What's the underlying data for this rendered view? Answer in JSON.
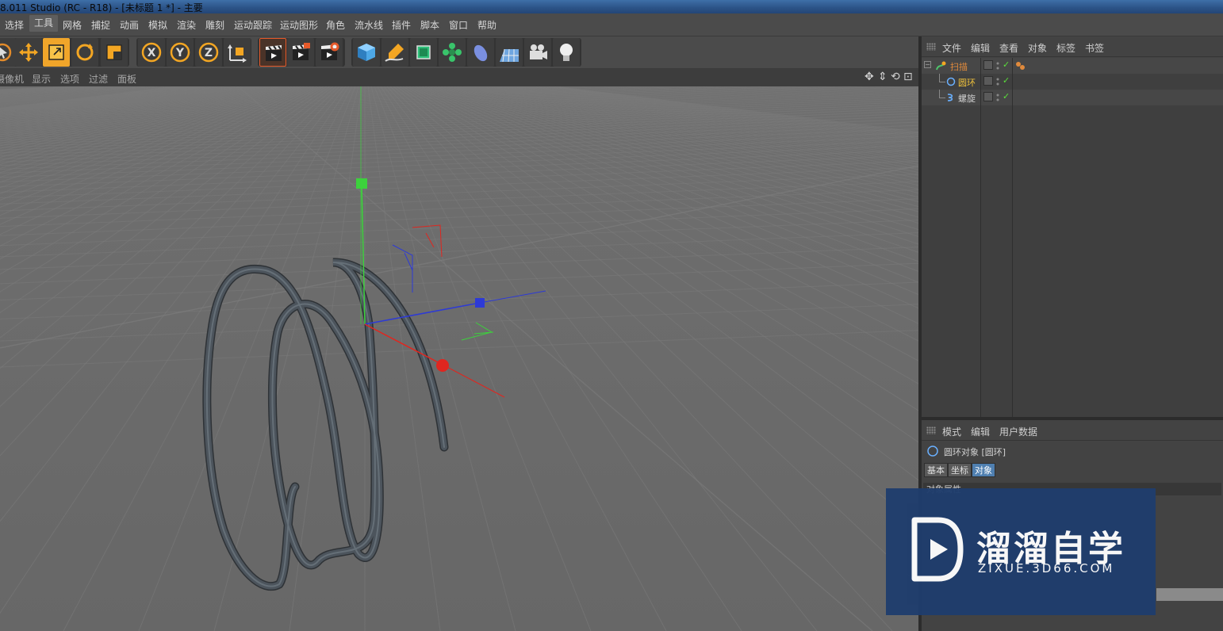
{
  "window": {
    "title": "8.011 Studio (RC - R18) - [未标题 1 *] - 主要"
  },
  "menu": {
    "items": [
      "选择",
      "工具",
      "网格",
      "捕捉",
      "动画",
      "模拟",
      "渲染",
      "雕刻",
      "运动跟踪",
      "运动图形",
      "角色",
      "流水线",
      "插件",
      "脚本",
      "窗口",
      "帮助"
    ],
    "active": "工具"
  },
  "toolbar": {
    "groups": [
      {
        "tools": [
          "select-tool",
          "move-tool",
          "scale-tool",
          "rotate-tool",
          "scale-tool-2"
        ]
      },
      {
        "tools": [
          "x-axis-lock",
          "y-axis-lock",
          "z-axis-lock",
          "world-coordinate-toggle"
        ]
      },
      {
        "tools": [
          "render-view",
          "render-to-picture-viewer",
          "render-settings"
        ]
      },
      {
        "tools": [
          "cube-primitive",
          "pen-spline",
          "subdivision-surface",
          "cloner",
          "bend-deformer",
          "floor-environment",
          "camera",
          "light"
        ]
      }
    ],
    "axis_labels": [
      "X",
      "Y",
      "Z"
    ]
  },
  "viewport": {
    "menu": [
      "摄像机",
      "显示",
      "选项",
      "过滤",
      "面板"
    ],
    "nav_icons": [
      "move-view-icon",
      "dolly-view-icon",
      "rotate-view-icon",
      "toggle-layout-icon"
    ],
    "nav_glyphs": [
      "✥",
      "⇕",
      "⟲",
      "⊡"
    ],
    "tube_color": "#4a5158",
    "axis_colors": {
      "x": "#e0261f",
      "y": "#3cd23c",
      "z": "#2d3ad6"
    },
    "grid_color": "#7c7c7c",
    "background": "#6d6d6d"
  },
  "object_manager": {
    "menu": [
      "文件",
      "编辑",
      "查看",
      "对象",
      "标签",
      "书签"
    ],
    "objects": [
      {
        "name": "扫描",
        "icon": "sweep-icon",
        "level": 0,
        "color": "#e08a3c",
        "expanded": true
      },
      {
        "name": "圆环",
        "icon": "circle-spline-icon",
        "level": 1,
        "color": "#f0c23c"
      },
      {
        "name": "螺旋",
        "icon": "helix-spline-icon",
        "level": 1,
        "color": "#cfcfcf"
      }
    ]
  },
  "attribute_manager": {
    "menu": [
      "模式",
      "编辑",
      "用户数据"
    ],
    "title": "圆环对象 [圆环]",
    "tabs": [
      "基本",
      "坐标",
      "对象"
    ],
    "active_tab": "对象",
    "section": "对象属性"
  },
  "watermark": {
    "text": "溜溜自学",
    "url": "ZIXUE.3D66.COM"
  }
}
